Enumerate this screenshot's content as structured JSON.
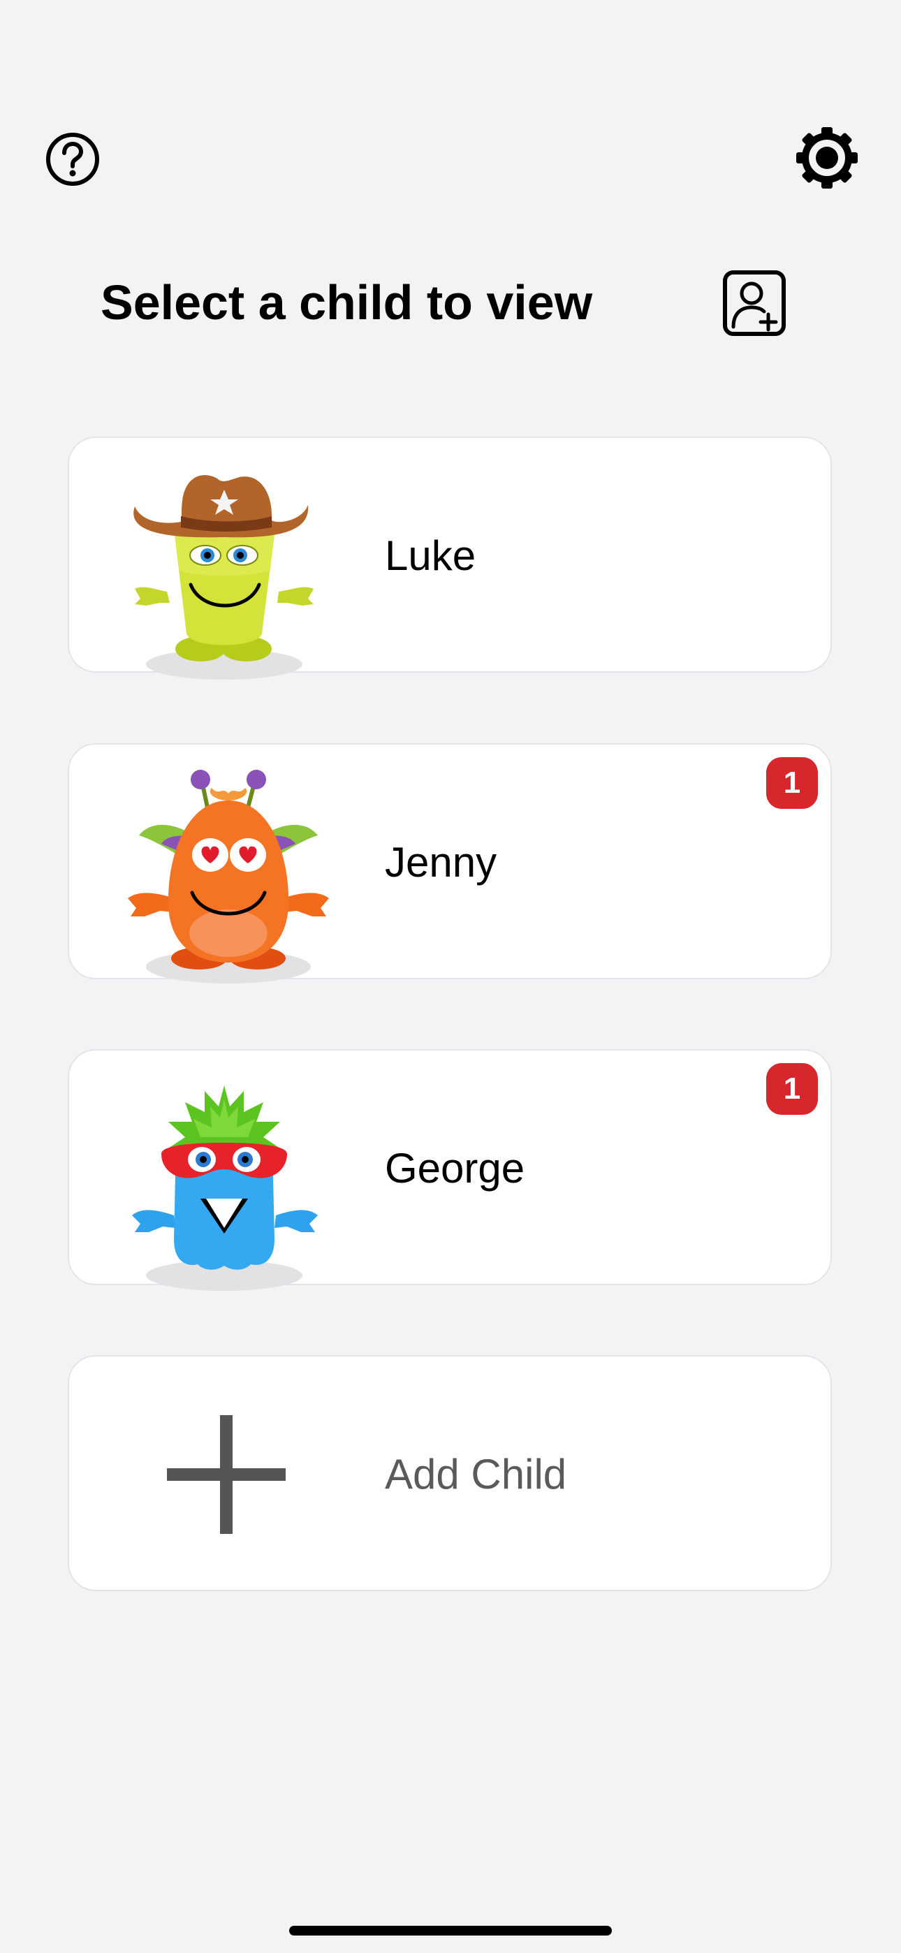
{
  "header": {
    "help_icon": "question-circle-icon",
    "settings_icon": "gear-icon",
    "title": "Select a child to view",
    "add_user_icon": "person-add-icon"
  },
  "children": [
    {
      "name": "Luke",
      "avatar": "cowboy-monster-avatar",
      "badge": ""
    },
    {
      "name": "Jenny",
      "avatar": "orange-alien-monster-avatar",
      "badge": "1"
    },
    {
      "name": "George",
      "avatar": "blue-masked-monster-avatar",
      "badge": "1"
    }
  ],
  "add_child": {
    "label": "Add Child",
    "icon": "plus-icon"
  },
  "colors": {
    "background": "#f2f3f5",
    "card": "#ffffff",
    "badge": "#d7262c",
    "add_label": "#5a5a5a"
  }
}
